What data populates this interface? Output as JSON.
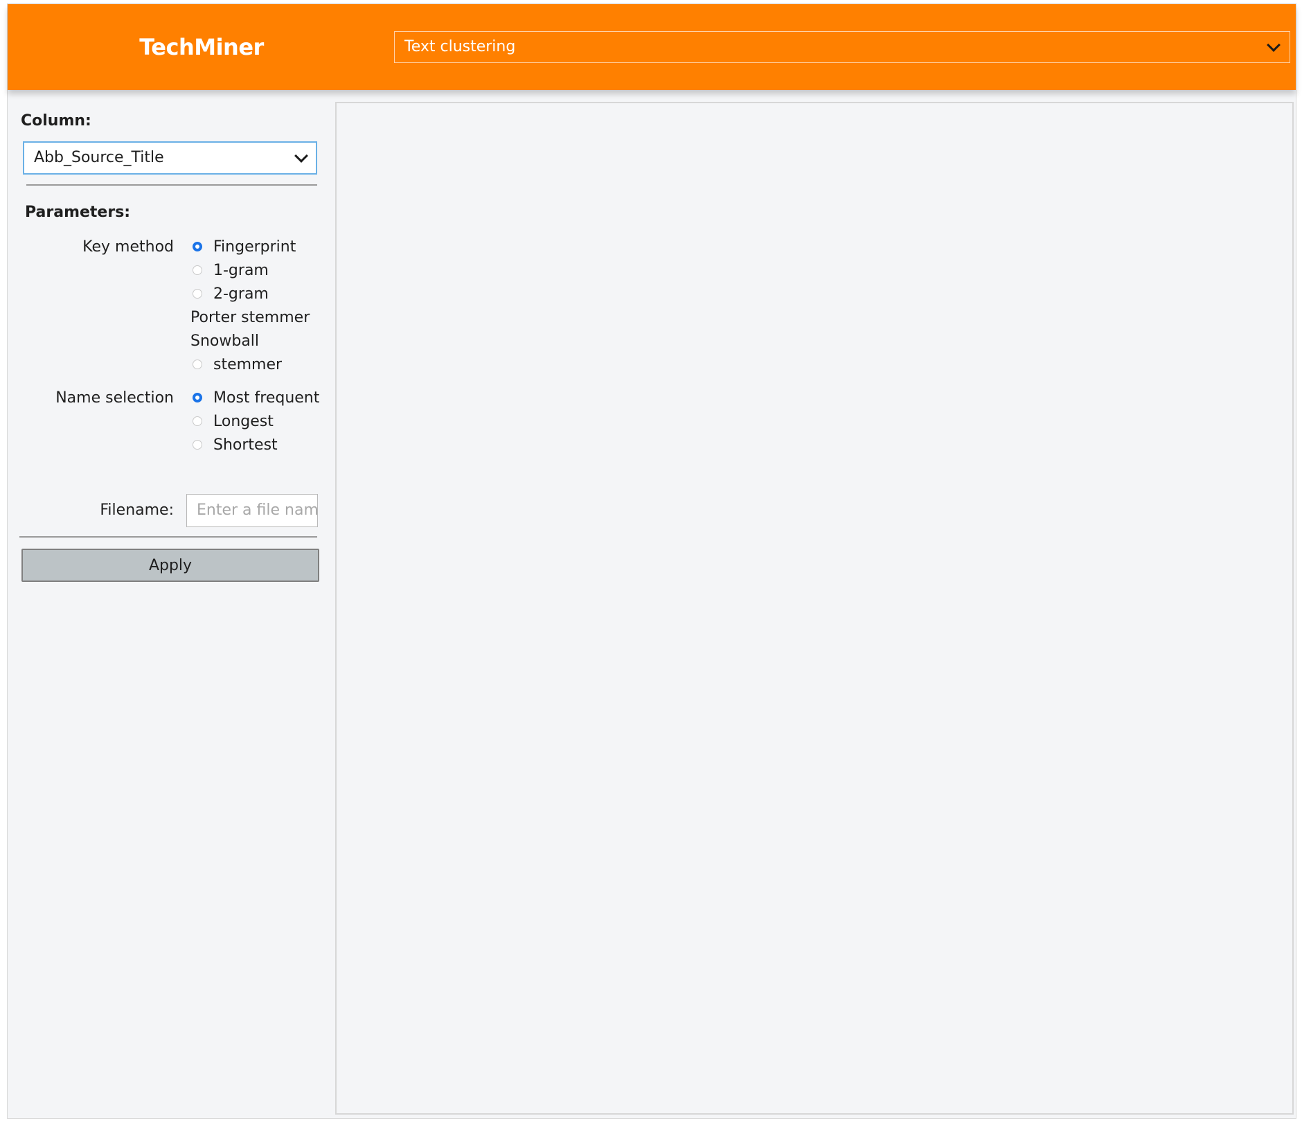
{
  "header": {
    "app_title": "TechMiner",
    "module_select": {
      "value": "Text clustering"
    }
  },
  "panel": {
    "column_label": "Column:",
    "column_select": {
      "value": "Abb_Source_Title"
    },
    "parameters_label": "Parameters:",
    "key_method": {
      "label": "Key method",
      "options": [
        {
          "label": "Fingerprint",
          "checked": true
        },
        {
          "label": "1-gram",
          "checked": false
        },
        {
          "label": "2-gram",
          "checked": false
        },
        {
          "label_line1": "Porter stemmer",
          "checked": false
        },
        {
          "label_line1": "Snowball",
          "label_line2": "stemmer",
          "checked": false
        }
      ]
    },
    "name_selection": {
      "label": "Name selection",
      "options": [
        {
          "label": "Most frequent",
          "checked": true
        },
        {
          "label": "Longest",
          "checked": false
        },
        {
          "label": "Shortest",
          "checked": false
        }
      ]
    },
    "filename": {
      "label": "Filename:",
      "placeholder": "Enter a file name",
      "value": ""
    },
    "apply_label": "Apply"
  },
  "colors": {
    "header_bg": "#ff8000",
    "radio_accent": "#1a73e8",
    "focus_border": "#6ab0e6",
    "apply_button_bg": "#bcc3c6",
    "panel_bg": "#f4f5f7"
  }
}
